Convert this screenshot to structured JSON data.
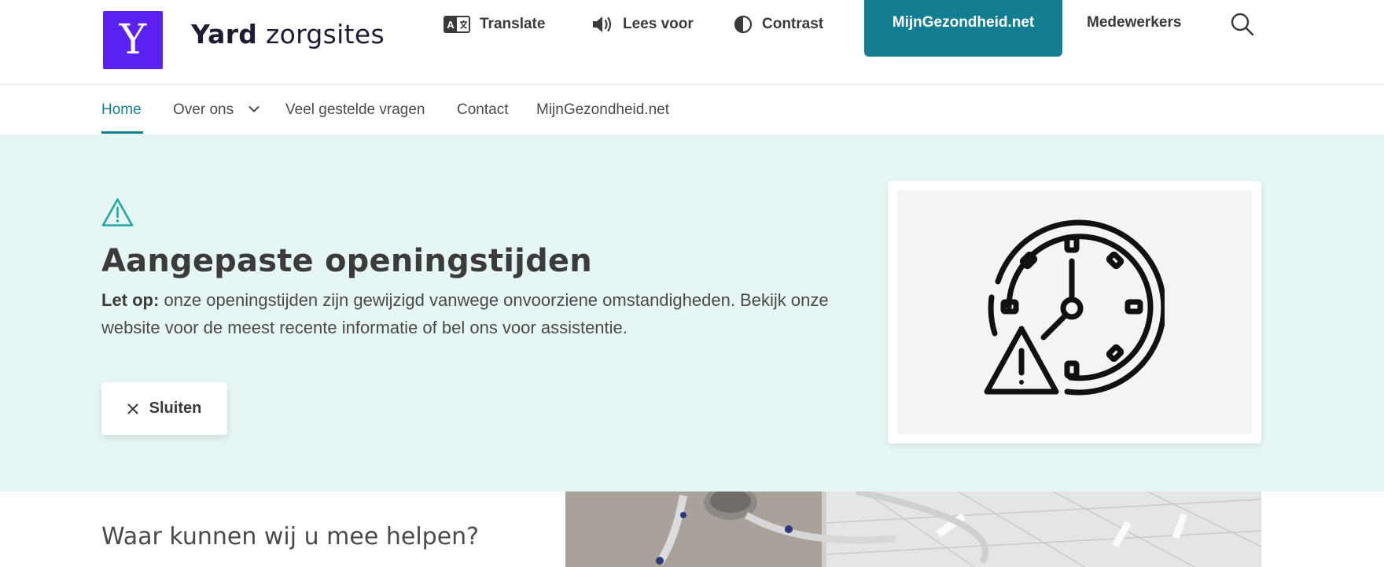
{
  "header": {
    "logo_letter": "Y",
    "brand_strong": "Yard",
    "brand_light": "zorgsites",
    "utilities": {
      "translate": "Translate",
      "read_aloud": "Lees voor",
      "contrast": "Contrast"
    },
    "cta_label": "MijnGezondheid.net",
    "staff_label": "Medewerkers",
    "search_icon": "search-icon"
  },
  "nav": {
    "items": [
      {
        "label": "Home",
        "active": true
      },
      {
        "label": "Over ons",
        "has_dropdown": true
      },
      {
        "label": "Veel gestelde vragen"
      },
      {
        "label": "Contact"
      },
      {
        "label": "MijnGezondheid.net"
      }
    ]
  },
  "alert": {
    "icon": "warning-icon",
    "title": "Aangepaste openingstijden",
    "emphasis": "Let op:",
    "body": "onze openingstijden zijn gewijzigd vanwege onvoorziene omstandigheden. Bekijk onze website voor de meest recente informatie of bel ons voor assistentie.",
    "close_label": "Sluiten",
    "illustration": "clock-warning-icon"
  },
  "main": {
    "help_title": "Waar kunnen wij u mee helpen?",
    "hero_image": "operating-room-photo"
  },
  "colors": {
    "brand_purple": "#5b21f0",
    "accent_teal": "#137d92",
    "alert_background": "#e6f6f4",
    "warning_icon": "#1fa9a3"
  }
}
